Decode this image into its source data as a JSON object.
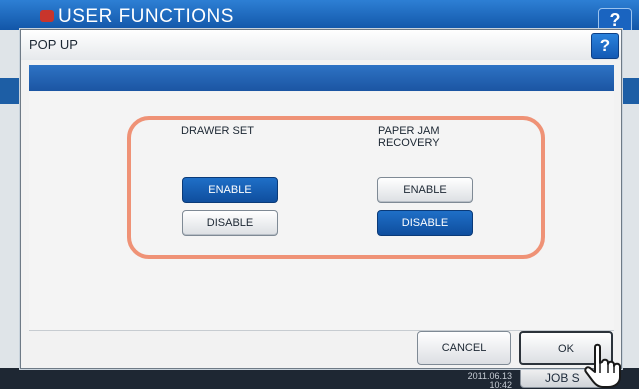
{
  "background": {
    "title": "USER FUNCTIONS",
    "help_label": "?",
    "clock_date": "2011.06.13",
    "clock_time": "10:42",
    "job_status_label": "JOB S"
  },
  "popup": {
    "title": "POP UP",
    "help_label": "?",
    "columns": [
      {
        "label_lines": [
          "DRAWER SET"
        ],
        "options": [
          {
            "label": "ENABLE",
            "selected": true
          },
          {
            "label": "DISABLE",
            "selected": false
          }
        ]
      },
      {
        "label_lines": [
          "PAPER JAM",
          "RECOVERY"
        ],
        "options": [
          {
            "label": "ENABLE",
            "selected": false
          },
          {
            "label": "DISABLE",
            "selected": true
          }
        ]
      }
    ],
    "cancel_label": "CANCEL",
    "ok_label": "OK"
  },
  "colors": {
    "accent_blue": "#1b55a3",
    "selected_button": "#0f4e9e",
    "highlight_ring": "#ef9276"
  },
  "icons": [
    "help-icon",
    "printer-logo-icon",
    "pointing-hand-icon"
  ]
}
